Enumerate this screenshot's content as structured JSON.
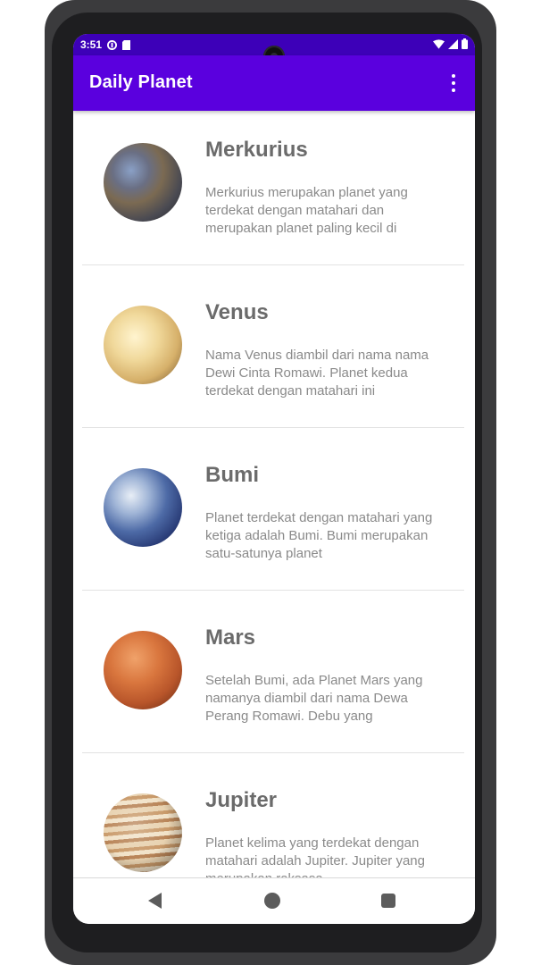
{
  "status_bar": {
    "time": "3:51",
    "left_icons": [
      "data-saver-icon",
      "sd-card-icon"
    ],
    "right_icons": [
      "wifi-icon",
      "signal-icon",
      "battery-icon"
    ]
  },
  "app_bar": {
    "title": "Daily Planet",
    "menu_icon": "more-vert-icon"
  },
  "planets": [
    {
      "name": "Merkurius",
      "description": "Merkurius merupakan planet yang terdekat dengan matahari dan merupakan planet paling kecil di"
    },
    {
      "name": "Venus",
      "description": "Nama Venus diambil dari nama nama Dewi Cinta Romawi. Planet kedua terdekat dengan matahari ini"
    },
    {
      "name": "Bumi",
      "description": "Planet terdekat dengan matahari yang ketiga adalah Bumi. Bumi merupakan satu-satunya planet"
    },
    {
      "name": "Mars",
      "description": "Setelah Bumi, ada Planet Mars yang namanya diambil dari nama Dewa Perang Romawi. Debu yang"
    },
    {
      "name": "Jupiter",
      "description": "Planet kelima yang terdekat dengan matahari adalah Jupiter. Jupiter yang merupakan raksasa"
    }
  ],
  "nav_bar": {
    "icons": [
      "back-icon",
      "home-icon",
      "recents-icon"
    ]
  },
  "colors": {
    "status_bar": "#3d00b8",
    "app_bar": "#5a00de",
    "title_text": "#6b6b6b",
    "desc_text": "#8a8a8a"
  }
}
